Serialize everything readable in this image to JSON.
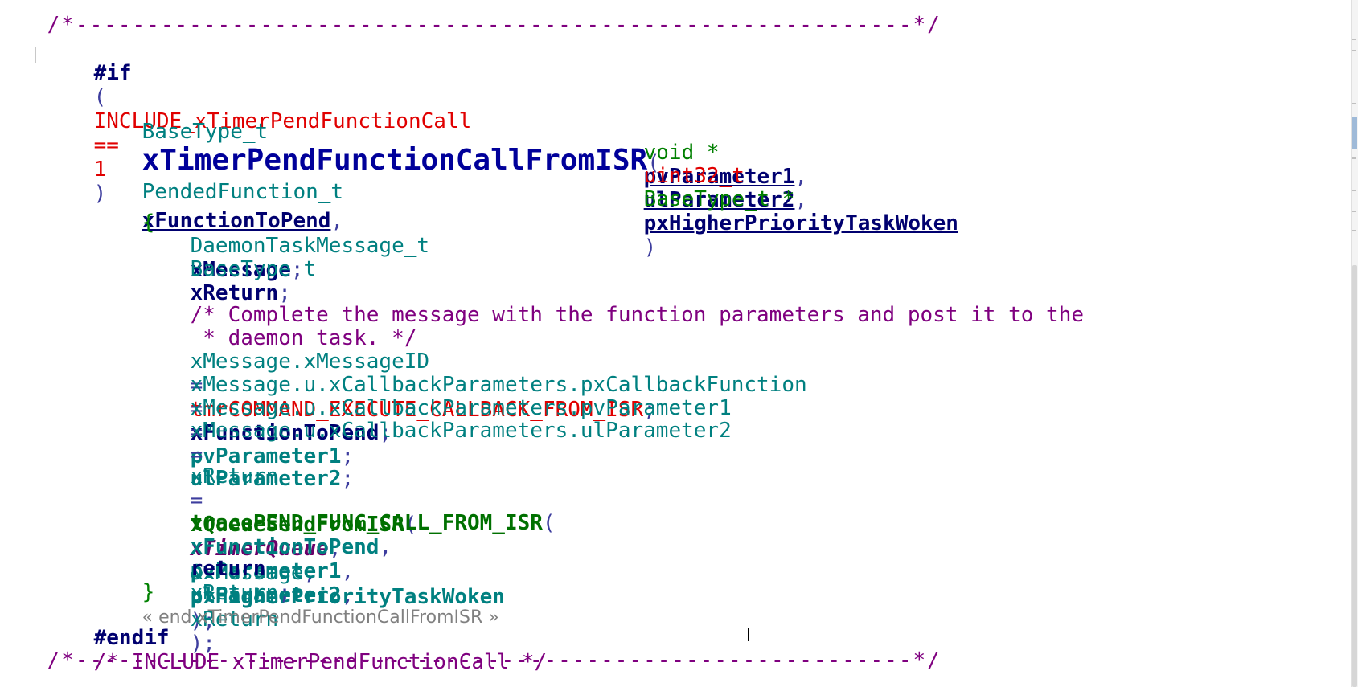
{
  "editor": {
    "separator_top": "/*-----------------------------------------------------------*/",
    "separator_bottom": "/*-----------------------------------------------------------*/",
    "if_directive": {
      "keyword": "#if",
      "open": "(",
      "macro": "INCLUDE_xTimerPendFunctionCall",
      "op": "==",
      "value": "1",
      "close": ")"
    },
    "signature": {
      "return_type": "BaseType_t",
      "function_name": "xTimerPendFunctionCallFromISR",
      "open_paren": "(",
      "p1_type": "PendedFunction_t",
      "p1_name": "xFunctionToPend",
      "p2_type": "void *",
      "p2_name": "pvParameter1",
      "p3_type": "uint32_t",
      "p3_name": "ulParameter2",
      "p4_type": "BaseType_t *",
      "p4_name": "pxHigherPriorityTaskWoken",
      "close_paren": ")",
      "comma": ","
    },
    "open_brace": "{",
    "decl1_type": "DaemonTaskMessage_t",
    "decl1_name": "xMessage",
    "decl2_type": "BaseType_t",
    "decl2_name": "xReturn",
    "semicolon": ";",
    "comment_line1": "/* Complete the message with the function parameters and post it to the",
    "comment_line2": " * daemon task. */",
    "assign1_lhs": "xMessage.xMessageID",
    "assign1_rhs": "tmrCOMMAND_EXECUTE_CALLBACK_FROM_ISR",
    "assign2_lhs": "xMessage.u.xCallbackParameters.pxCallbackFunction",
    "assign2_rhs": "xFunctionToPend",
    "assign3_lhs": "xMessage.u.xCallbackParameters.pvParameter1",
    "assign3_rhs": "pvParameter1",
    "assign4_lhs": "xMessage.u.xCallbackParameters.ulParameter2",
    "assign4_rhs": "ulParameter2",
    "equals": "=",
    "send_lhs": "xReturn",
    "send_fn": "xQueueSendFromISR",
    "send_arg1": "xTimerQueue",
    "send_arg2": "&xMessage",
    "send_arg3": "pxHigherPriorityTaskWoken",
    "trace_fn": "tracePEND_FUNC_CALL_FROM_ISR",
    "trace_arg1": "xFunctionToPend",
    "trace_arg2": "pvParameter1",
    "trace_arg3": "ulParameter2",
    "trace_arg4": "xReturn",
    "return_kw": "return",
    "return_val": "xReturn",
    "close_brace": "}",
    "end_annotation": "« end xTimerPendFunctionCallFromISR »",
    "endif_kw": "#endif",
    "endif_comment": "/* INCLUDE_xTimerPendFunctionCall */"
  },
  "colors": {
    "keyword": "#00006f",
    "macro": "#e00000",
    "type": "#008080",
    "comment": "#7f007f",
    "call": "#007000",
    "background": "#ffffff"
  }
}
